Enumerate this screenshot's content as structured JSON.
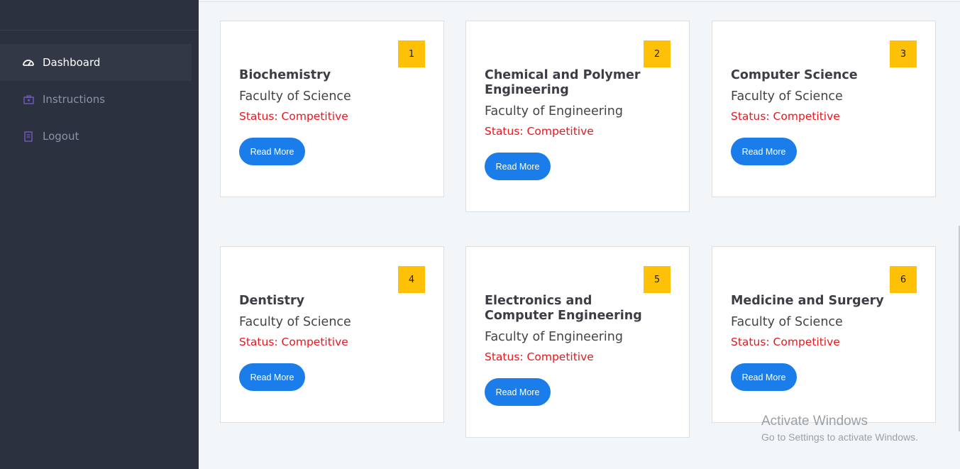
{
  "sidebar": {
    "items": [
      {
        "label": "Dashboard",
        "icon": "dashboard-icon",
        "active": true
      },
      {
        "label": "Instructions",
        "icon": "briefcase-icon",
        "active": false
      },
      {
        "label": "Logout",
        "icon": "book-icon",
        "active": false
      }
    ]
  },
  "cards": [
    {
      "number": "1",
      "title": "Biochemistry",
      "faculty": "Faculty of Science",
      "status": "Status: Competitive",
      "button": "Read More"
    },
    {
      "number": "2",
      "title": "Chemical and Polymer Engineering",
      "faculty": "Faculty of Engineering",
      "status": "Status: Competitive",
      "button": "Read More"
    },
    {
      "number": "3",
      "title": "Computer Science",
      "faculty": "Faculty of Science",
      "status": "Status: Competitive",
      "button": "Read More"
    },
    {
      "number": "4",
      "title": "Dentistry",
      "faculty": "Faculty of Science",
      "status": "Status: Competitive",
      "button": "Read More"
    },
    {
      "number": "5",
      "title": "Electronics and Computer Engineering",
      "faculty": "Faculty of Engineering",
      "status": "Status: Competitive",
      "button": "Read More"
    },
    {
      "number": "6",
      "title": "Medicine and Surgery",
      "faculty": "Faculty of Science",
      "status": "Status: Competitive",
      "button": "Read More"
    }
  ],
  "watermark": {
    "line1": "Activate Windows",
    "line2": "Go to Settings to activate Windows."
  },
  "colors": {
    "sidebar_bg": "#2c3140",
    "badge": "#ffc107",
    "button": "#1b7dea",
    "status": "#e8171e"
  }
}
